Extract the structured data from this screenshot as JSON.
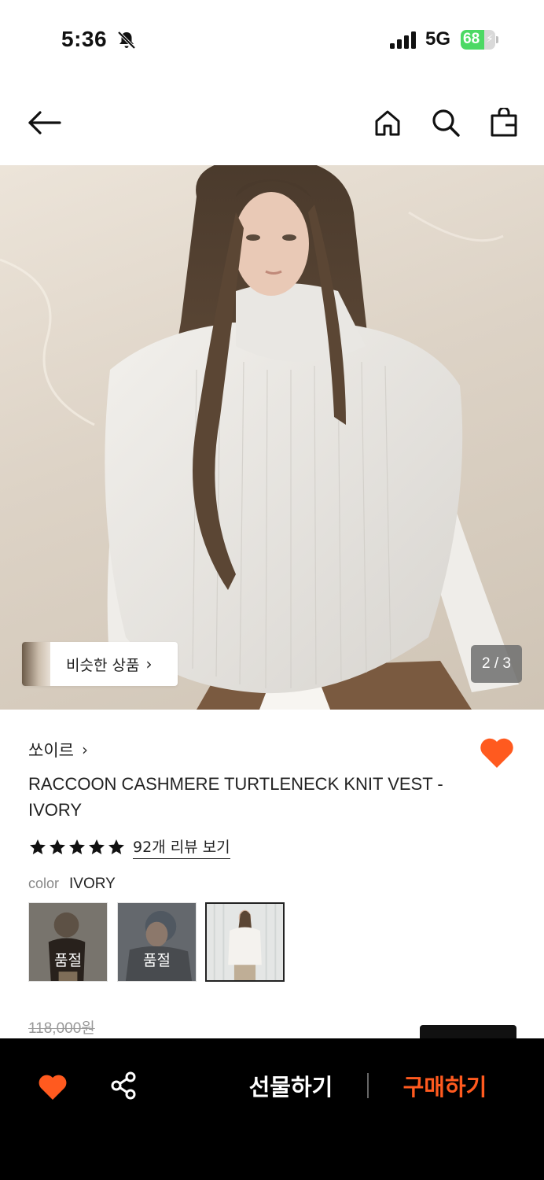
{
  "status_bar": {
    "time": "5:36",
    "network": "5G",
    "battery_level": "68",
    "battery_fraction": 0.68,
    "icons": [
      "bell-slash-icon",
      "signal-bars-icon",
      "battery-charging-icon"
    ]
  },
  "nav": {
    "icons": [
      "back-arrow-icon",
      "home-icon",
      "search-icon",
      "shopping-bag-icon"
    ]
  },
  "hero": {
    "similar_products_label": "비슷한 상품",
    "page_indicator": "2 / 3"
  },
  "product": {
    "brand": "쏘이르",
    "title": "RACCOON CASHMERE TURTLENECK KNIT VEST - IVORY",
    "rating_stars": 5,
    "review_link": "92개 리뷰 보기",
    "liked": true,
    "color_label": "color",
    "color_value": "IVORY",
    "swatches": [
      {
        "sold_out_label": "품절",
        "selected": false
      },
      {
        "sold_out_label": "품절",
        "selected": false
      },
      {
        "sold_out_label": "",
        "selected": true
      }
    ],
    "original_price": "118,000원"
  },
  "bottom_bar": {
    "gift_label": "선물하기",
    "buy_label": "구매하기",
    "icons": [
      "heart-icon",
      "share-icon"
    ]
  },
  "colors": {
    "accent": "#ff5a1f",
    "bottom_bar_bg": "#000000",
    "star": "#111111"
  }
}
